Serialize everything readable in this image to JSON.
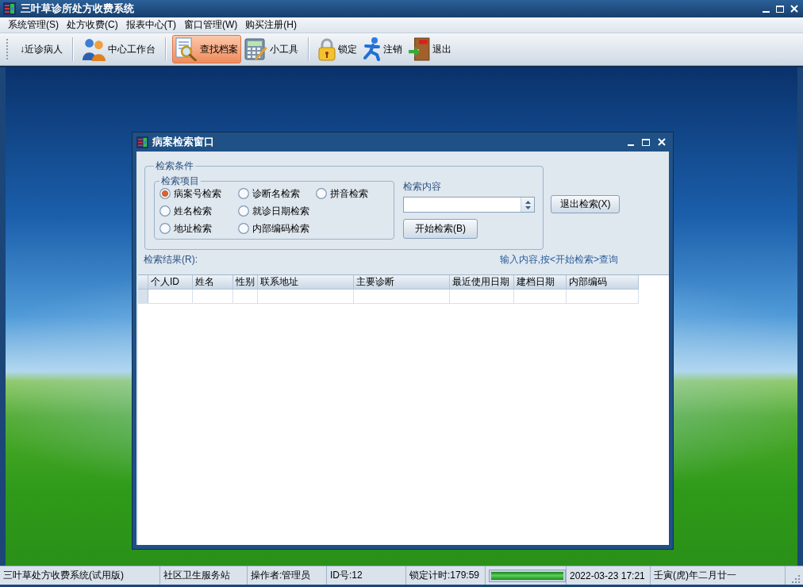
{
  "window": {
    "title": "三叶草诊所处方收费系统"
  },
  "menu_bar": {
    "items": [
      "系统管理(S)",
      "处方收费(C)",
      "报表中心(T)",
      "窗口管理(W)",
      "购买注册(H)"
    ]
  },
  "toolbar": {
    "groups": [
      {
        "items": [
          {
            "kind": "text",
            "label": "↓近诊病人",
            "selected": false
          }
        ]
      },
      {
        "items": [
          {
            "kind": "icon",
            "label": "中心工作台",
            "selected": false
          }
        ]
      },
      {
        "items": [
          {
            "kind": "icon",
            "label": "查找档案",
            "selected": true
          },
          {
            "kind": "icon",
            "label": "小工具",
            "selected": false
          }
        ]
      },
      {
        "items": [
          {
            "kind": "icon",
            "label": "锁定",
            "selected": false
          },
          {
            "kind": "icon",
            "label": "注销",
            "selected": false
          },
          {
            "kind": "icon",
            "label": "退出",
            "selected": false
          }
        ]
      }
    ]
  },
  "dialog": {
    "title": "病案检索窗口",
    "conditions_group": {
      "label": "检索条件",
      "items_group": {
        "label": "检索项目",
        "options": [
          {
            "label": "病案号检索",
            "selected": true
          },
          {
            "label": "姓名检索",
            "selected": false
          },
          {
            "label": "地址检索",
            "selected": false
          },
          {
            "label": "诊断名检索",
            "selected": false
          },
          {
            "label": "就诊日期检索",
            "selected": false
          },
          {
            "label": "内部编码检索",
            "selected": false
          },
          {
            "label": "拼音检索",
            "selected": false
          }
        ]
      },
      "content_label": "检索内容",
      "start_button": "开始检索(B)"
    },
    "exit_button": "退出检索(X)",
    "results_label": "检索结果(R):",
    "hint": "输入内容,按<开始检索>查询",
    "table": {
      "columns": [
        "个人ID",
        "姓名",
        "性别",
        "联系地址",
        "主要诊断",
        "最近使用日期",
        "建档日期",
        "内部编码"
      ]
    }
  },
  "status_bar": {
    "items": [
      {
        "kind": "text",
        "text": "三叶草处方收费系统(试用版)"
      },
      {
        "kind": "text",
        "text": "社区卫生服务站"
      },
      {
        "kind": "text",
        "text": "操作者:管理员"
      },
      {
        "kind": "text",
        "text": "ID号:12"
      },
      {
        "kind": "text",
        "text": "锁定计时:179:59"
      },
      {
        "kind": "progress",
        "level": 1
      },
      {
        "kind": "text",
        "text": "2022-03-23 17:21"
      },
      {
        "kind": "text",
        "text": "壬寅(虎)年二月廿一"
      }
    ]
  }
}
